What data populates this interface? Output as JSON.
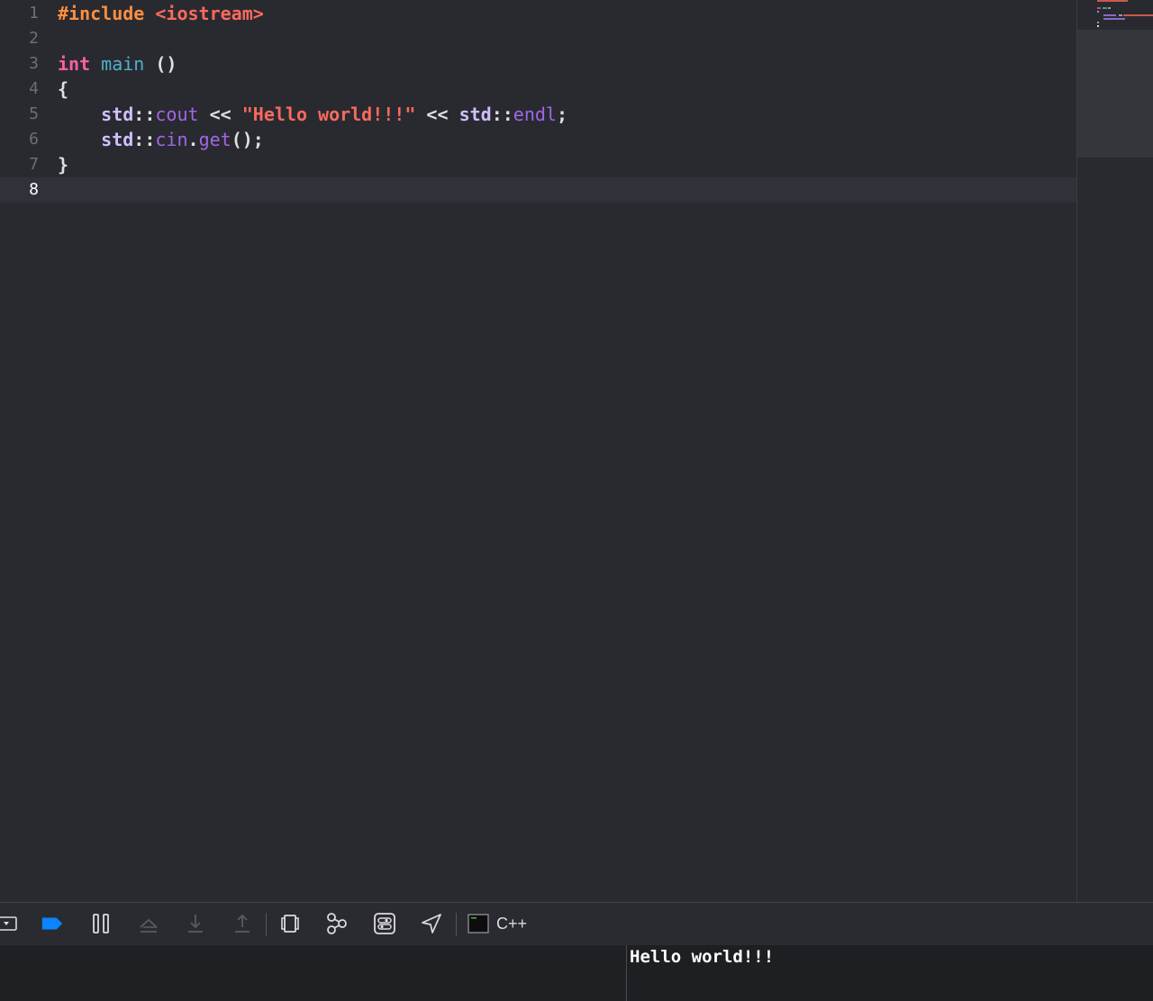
{
  "editor": {
    "current_line": 8,
    "lines": [
      {
        "number": "1",
        "tokens": [
          {
            "t": "#include ",
            "k": "pre"
          },
          {
            "t": "<iostream>",
            "k": "str"
          }
        ]
      },
      {
        "number": "2",
        "tokens": []
      },
      {
        "number": "3",
        "tokens": [
          {
            "t": "int",
            "k": "kw"
          },
          {
            "t": " ",
            "k": "pun"
          },
          {
            "t": "main",
            "k": "fn"
          },
          {
            "t": " ()",
            "k": "pun"
          }
        ]
      },
      {
        "number": "4",
        "tokens": [
          {
            "t": "{",
            "k": "pun"
          }
        ]
      },
      {
        "number": "5",
        "tokens": [
          {
            "t": "    ",
            "k": "pun"
          },
          {
            "t": "std",
            "k": "ns"
          },
          {
            "t": "::",
            "k": "pun"
          },
          {
            "t": "cout",
            "k": "mem"
          },
          {
            "t": " << ",
            "k": "pun"
          },
          {
            "t": "\"Hello world!!!\"",
            "k": "str"
          },
          {
            "t": " << ",
            "k": "pun"
          },
          {
            "t": "std",
            "k": "ns"
          },
          {
            "t": "::",
            "k": "pun"
          },
          {
            "t": "endl",
            "k": "mem"
          },
          {
            "t": ";",
            "k": "pun"
          }
        ]
      },
      {
        "number": "6",
        "tokens": [
          {
            "t": "    ",
            "k": "pun"
          },
          {
            "t": "std",
            "k": "ns"
          },
          {
            "t": "::",
            "k": "pun"
          },
          {
            "t": "cin",
            "k": "mem"
          },
          {
            "t": ".",
            "k": "pun"
          },
          {
            "t": "get",
            "k": "mem"
          },
          {
            "t": "();",
            "k": "pun"
          }
        ]
      },
      {
        "number": "7",
        "tokens": [
          {
            "t": "}",
            "k": "pun"
          }
        ]
      },
      {
        "number": "8",
        "tokens": []
      }
    ]
  },
  "colors": {
    "background": "#292a30",
    "preprocessor": "#fd8f3f",
    "keyword": "#fc5fa3",
    "function": "#4eb0cc",
    "namespace": "#d0bfff",
    "member": "#a167e6",
    "string": "#fc6a5d",
    "accent_blue": "#0a84ff"
  },
  "debug_bar": {
    "buttons": [
      {
        "name": "hide-debug-area-button",
        "icon": "hide-panel-icon"
      },
      {
        "name": "breakpoints-toggle-button",
        "icon": "breakpoint-icon"
      },
      {
        "name": "pause-button",
        "icon": "pause-icon"
      },
      {
        "name": "step-over-button",
        "icon": "step-over-icon"
      },
      {
        "name": "step-into-button",
        "icon": "step-into-icon"
      },
      {
        "name": "step-out-button",
        "icon": "step-out-icon"
      },
      {
        "name": "view-hierarchy-button",
        "icon": "view-hierarchy-icon"
      },
      {
        "name": "memory-graph-button",
        "icon": "memory-graph-icon"
      },
      {
        "name": "environment-overrides-button",
        "icon": "environment-overrides-icon"
      },
      {
        "name": "simulate-location-button",
        "icon": "location-icon"
      }
    ],
    "scheme_label": "C++"
  },
  "console": {
    "output": "Hello world!!!"
  }
}
